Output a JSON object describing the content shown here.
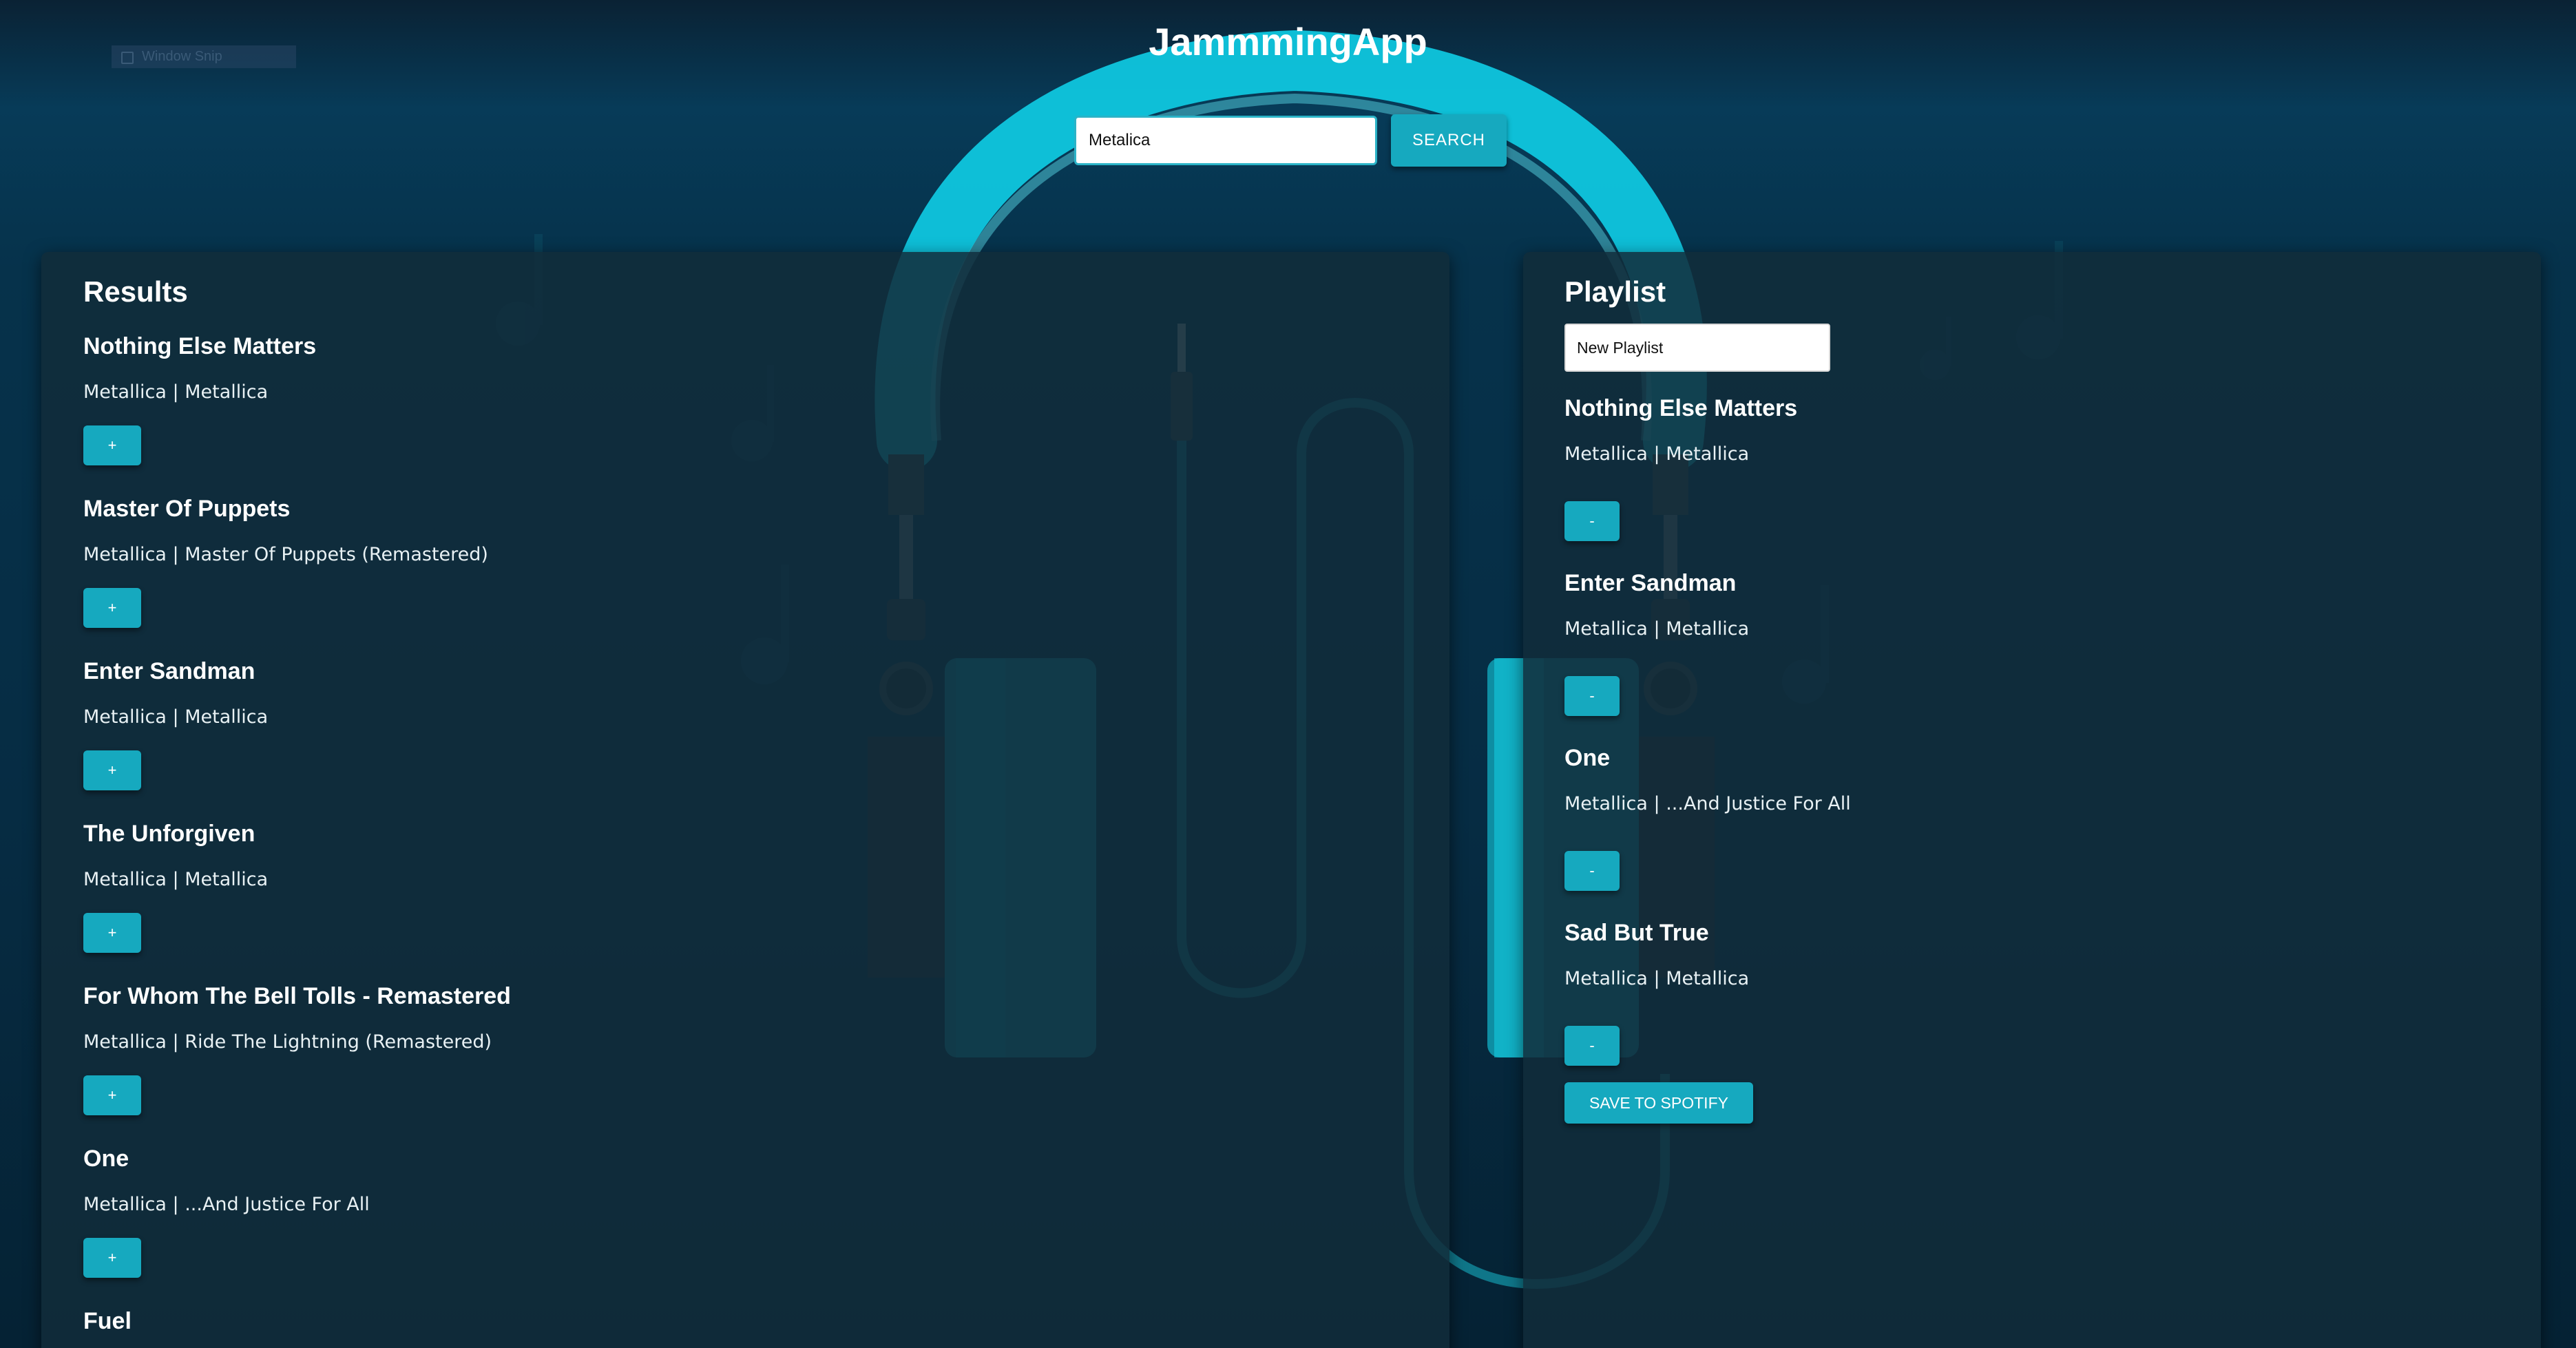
{
  "window_snip_label": "Window Snip",
  "app": {
    "title": "JammmingApp"
  },
  "search": {
    "value": "Metalica",
    "button_label": "SEARCH"
  },
  "colors": {
    "accent": "#16a9bf",
    "headphone_band": "#0fd8ee",
    "background": "#06324b",
    "panel": "#112c3a"
  },
  "results": {
    "heading": "Results",
    "add_label": "+",
    "tracks": [
      {
        "name": "Nothing Else Matters",
        "info": "Metallica | Metallica"
      },
      {
        "name": "Master Of Puppets",
        "info": "Metallica | Master Of Puppets (Remastered)"
      },
      {
        "name": "Enter Sandman",
        "info": "Metallica | Metallica"
      },
      {
        "name": "The Unforgiven",
        "info": "Metallica | Metallica"
      },
      {
        "name": "For Whom The Bell Tolls - Remastered",
        "info": "Metallica | Ride The Lightning (Remastered)"
      },
      {
        "name": "One",
        "info": "Metallica | ...And Justice For All"
      },
      {
        "name": "Fuel",
        "info": ""
      }
    ]
  },
  "playlist": {
    "heading": "Playlist",
    "name_value": "New Playlist",
    "remove_label": "-",
    "save_label": "SAVE TO SPOTIFY",
    "tracks": [
      {
        "name": "Nothing Else Matters",
        "info": "Metallica | Metallica"
      },
      {
        "name": "Enter Sandman",
        "info": "Metallica | Metallica"
      },
      {
        "name": "One",
        "info": "Metallica | ...And Justice For All"
      },
      {
        "name": "Sad But True",
        "info": "Metallica | Metallica"
      }
    ]
  }
}
